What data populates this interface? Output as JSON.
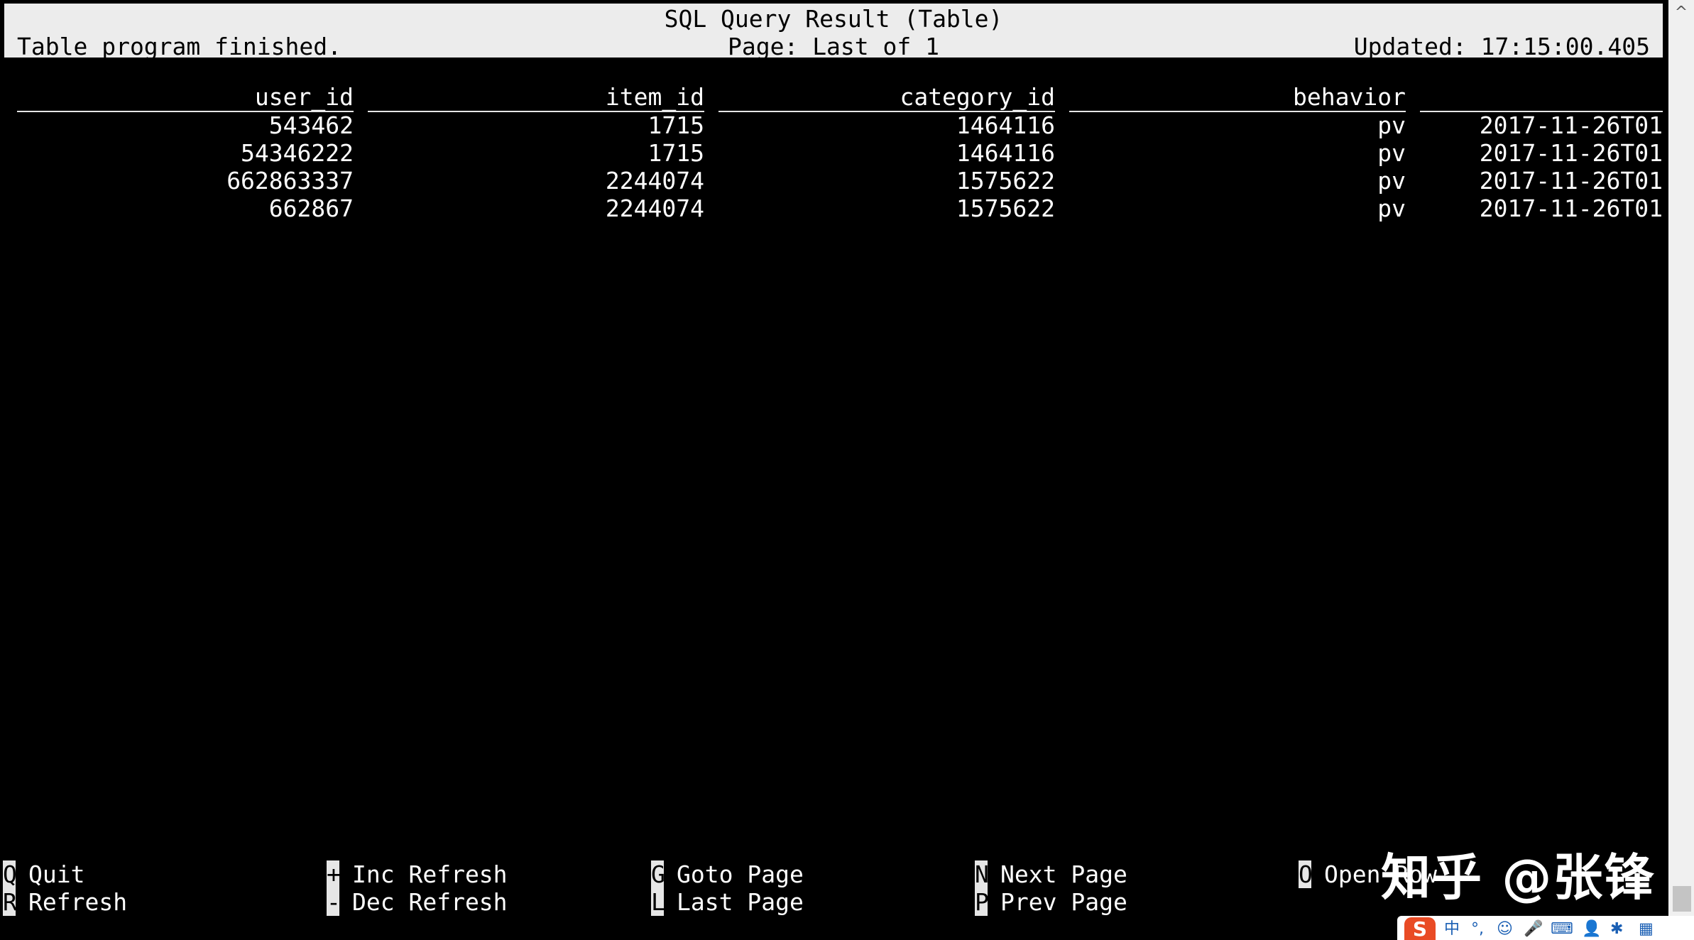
{
  "header": {
    "title": "SQL Query Result (Table)",
    "status": "Table program finished.",
    "page": "Page: Last of 1",
    "updated": "Updated: 17:15:00.405"
  },
  "table": {
    "columns": [
      "user_id",
      "item_id",
      "category_id",
      "behavior",
      ""
    ],
    "rows": [
      [
        "543462",
        "1715",
        "1464116",
        "pv",
        "2017-11-26T01"
      ],
      [
        "54346222",
        "1715",
        "1464116",
        "pv",
        "2017-11-26T01"
      ],
      [
        "662863337",
        "2244074",
        "1575622",
        "pv",
        "2017-11-26T01"
      ],
      [
        "662867",
        "2244074",
        "1575622",
        "pv",
        "2017-11-26T01"
      ]
    ]
  },
  "footer": {
    "hints": [
      {
        "key": "Q",
        "label": "Quit"
      },
      {
        "key": "R",
        "label": "Refresh"
      },
      {
        "key": "+",
        "label": "Inc Refresh"
      },
      {
        "key": "-",
        "label": "Dec Refresh"
      },
      {
        "key": "G",
        "label": "Goto Page"
      },
      {
        "key": "L",
        "label": "Last Page"
      },
      {
        "key": "N",
        "label": "Next Page"
      },
      {
        "key": "P",
        "label": "Prev Page"
      },
      {
        "key": "O",
        "label": "Open Row"
      }
    ]
  },
  "watermark": "知乎 @张锋",
  "scrollbar": {
    "up_arrow": "^"
  },
  "tray": {
    "ime_logo": "S",
    "ime_lang": "中",
    "icons": [
      "punctuation-icon",
      "emoji-icon",
      "microphone-icon",
      "keyboard-icon",
      "user-icon",
      "settings-icon",
      "grid-icon"
    ]
  }
}
